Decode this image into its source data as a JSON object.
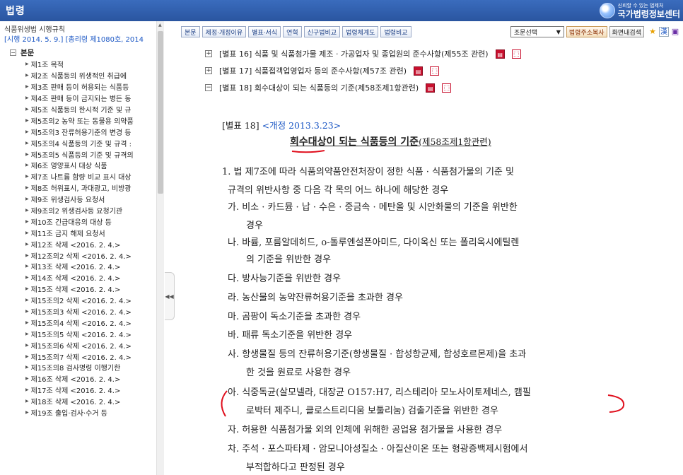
{
  "header": {
    "title": "법령",
    "brand_slogan": "신뢰할 수 있는 법제처",
    "brand_name": "국가법령정보센터"
  },
  "sidebar": {
    "law_title": "식품위생법 시행규칙",
    "law_subtitle": "[시행 2014. 5. 9.] [총리령 제1080호, 2014",
    "root_label": "본문",
    "items": [
      "제1조 목적",
      "제2조 식품등의 위생적인 취급에",
      "제3조 판매 등이 허용되는 식품등",
      "제4조 판매 등이 금지되는 병든 동",
      "제5조 식품등의 한시적 기준 및 규",
      "제5조의2 농약 또는 동물용 의약품",
      "제5조의3 잔류허용기준의 변경 등",
      "제5조의4 식품등의 기준 및 규격 :",
      "제5조의5 식품등의 기준 및 규격의",
      "제6조 영양표시 대상 식품",
      "제7조 나트륨 함량 비교 표시 대상",
      "제8조 허위표시, 과대광고, 비방광",
      "제9조 위생검사등 요청서",
      "제9조의2 위생검사등 요청기관",
      "제10조 긴급대응의 대상 등",
      "제11조 금지 해제 요청서",
      "제12조 삭제 <2016. 2. 4.>",
      "제12조의2 삭제 <2016. 2. 4.>",
      "제13조 삭제 <2016. 2. 4.>",
      "제14조 삭제 <2016. 2. 4.>",
      "제15조 삭제 <2016. 2. 4.>",
      "제15조의2 삭제 <2016. 2. 4.>",
      "제15조의3 삭제 <2016. 2. 4.>",
      "제15조의4 삭제 <2016. 2. 4.>",
      "제15조의5 삭제 <2016. 2. 4.>",
      "제15조의6 삭제 <2016. 2. 4.>",
      "제15조의7 삭제 <2016. 2. 4.>",
      "제15조의8 검사명령 이행기한",
      "제16조 삭제 <2016. 2. 4.>",
      "제17조 삭제 <2016. 2. 4.>",
      "제18조 삭제 <2016. 2. 4.>",
      "제19조 출입·검사·수거 등"
    ]
  },
  "toolbar": {
    "buttons": [
      "본문",
      "제정·개정이유",
      "별표·서식",
      "연혁",
      "신구법비교",
      "법령체계도",
      "법령비교"
    ],
    "select_value": "조문선택",
    "copy_address": "법령주소복사",
    "search_in_page": "화면내검색"
  },
  "annexes": [
    "[별표 16] 식품 및 식품첨가물 제조 · 가공업자 및 종업원의 준수사항(제55조 관련)",
    "[별표 17] 식품접객업영업자 등의 준수사항(제57조 관련)",
    "[별표 18] 회수대상이 되는 식품등의 기준(제58조제1항관련)"
  ],
  "document": {
    "annex_label": "[별표 18]",
    "revision": "<개정 2013.3.23>",
    "title_bold": "회수대상이 되는 식품등의 기준",
    "title_sub": "(제58조제1항관련)",
    "lines": [
      "1. 법 제7조에 따라 식품의약품안전처장이 정한 식품 · 식품첨가물의 기준 및",
      "규격의 위반사항 중 다음 각 목의 어느 하나에 해당한 경우",
      "가. 비소 · 카드뮴 · 납 · 수은 · 중금속 · 메탄올 및 시안화물의 기준을 위반한",
      "경우",
      "나. 바륨, 포름알데히드, o-톨루엔설폰아미드, 다이옥신 또는 폴리옥시에틸렌",
      "의 기준을 위반한 경우",
      "다. 방사능기준을 위반한 경우",
      "라. 농산물의 농약잔류허용기준을 초과한 경우",
      "마. 곰팡이 독소기준을 초과한 경우",
      "바. 패류 독소기준을 위반한 경우",
      "사. 항생물질 등의 잔류허용기준(항생물질 · 합성항균제, 합성호르몬제)을 초과",
      "한 것을 원료로 사용한 경우",
      "아. 식중독균(살모넬라, 대장균 O157:H7, 리스테리아 모노사이토제네스, 캠필",
      "로박터 제주니, 클로스트리디움 보툴리눔) 검출기준을 위반한 경우",
      "자. 허용한 식품첨가물 외의 인체에 위해한 공업용 첨가물을 사용한 경우",
      "차. 주석 · 포스파타제 · 암모니아성질소 · 아질산이온 또는 형광증백제시험에서",
      "부적합하다고 판정된 경우"
    ]
  },
  "colors": {
    "header": "#2f5fae",
    "link_blue": "#1a56c4",
    "annotation_red": "#e0101e"
  }
}
